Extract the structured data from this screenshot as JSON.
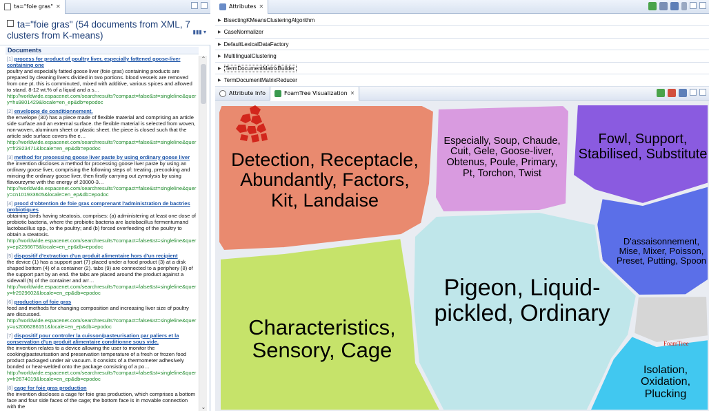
{
  "left_panel": {
    "tab_title": "ta=\"foie gras\"",
    "query_header": "ta=\"foie gras\" (54 documents from XML, 7 clusters from K-means)",
    "documents_label": "Documents",
    "documents": [
      {
        "num": "[1]",
        "title": "process for product of poultry liver, especially fattened goose-liver containing one",
        "snippet": "poultry and especially fatted goose liver (foie gras) containing products are prepared by cleaning livers divided in two portions. blood vessels are removed from one pt. this is comminuted, mixed with additive, various spices and allowed to stand. 8-12 wt.% of a liquid and a s…",
        "url": "http://worldwide.espacenet.com/searchresults?compact=false&st=singleline&query=hu9801429&locale=en_ep&db=epodoc"
      },
      {
        "num": "[2]",
        "title": "enveloppe de conditionnement.",
        "snippet": "the envelope (30) has a piece made of flexible material and comprising an article side surface and an external surface. the flexible material is selected from woven, non-woven, aluminum sheet or plastic sheet. the piece is closed such that the article side surface covers the e…",
        "url": "http://worldwide.espacenet.com/searchresults?compact=false&st=singleline&query=fr2923471&locale=en_ep&db=epodoc"
      },
      {
        "num": "[3]",
        "title": "method for processing goose liver paste by using ordinary goose liver",
        "snippet": "the invention discloses a method for processing goose liver paste by using an ordinary goose liver, comprising the following steps of: treating, precooking and mincing the ordinary goose liver, then firstly carrying out zymolysis by using flavourzyme with the energy of 20000-3…",
        "url": "http://worldwide.espacenet.com/searchresults?compact=false&st=singleline&query=cn101933605&locale=en_ep&db=epodoc"
      },
      {
        "num": "[4]",
        "title": "procd d'obtention de foie gras comprenant l'administration de bactries probiotiques",
        "snippet": "obtaining birds having steatosis, comprises: (a) administering at least one dose of probiotic bacteria, where the probiotic bacteria are lactobacillus fermentumand lactobacillus spp., to the poultry; and (b) forced overfeeding of the poultry to obtain a steatosis.",
        "url": "http://worldwide.espacenet.com/searchresults?compact=false&st=singleline&query=ep2256675&locale=en_ep&db=epodoc"
      },
      {
        "num": "[5]",
        "title": "dispositif d'extraction d'un produit alimentaire hors d'un recipient",
        "snippet": "the device (1) has a support part (7) placed under a food product (3) at a disk shaped bottom (4) of a container (2). tabs (9) are connected to a periphery (8) of the support part by an end. the tabs are placed around the product against a sidewall (5) of the container and arr…",
        "url": "http://worldwide.espacenet.com/searchresults?compact=false&st=singleline&query=fr2929602&locale=en_ep&db=epodoc"
      },
      {
        "num": "[6]",
        "title": "production of foie gras",
        "snippet": "feed and methods for changing composition and increasing liver size of poultry are discussed.",
        "url": "http://worldwide.espacenet.com/searchresults?compact=false&st=singleline&query=us2006286151&locale=en_ep&db=epodoc"
      },
      {
        "num": "[7]",
        "title": "dispositif pour controler la cuisson/pasteurisation par paliers et la conservation d'un produit alimentaire conditionne sous vide.",
        "snippet": "the invention relates to a device allowing the user to monitor the cooking/pasteurisation and preservation temperature of a fresh or frozen food product packaged under air vacuum. it consists of a thermometer adhesively bonded or heat-welded onto the package consisting of a po…",
        "url": "http://worldwide.espacenet.com/searchresults?compact=false&st=singleline&query=fr2674019&locale=en_ep&db=epodoc"
      },
      {
        "num": "[8]",
        "title": "cage for foie gras production",
        "snippet": "the invention discloses a cage for foie gras production, which comprises a bottom face and four side faces of the cage; the bottom face is in movable connection with the",
        "url": ""
      }
    ]
  },
  "attributes_panel": {
    "tab_title": "Attributes",
    "rows": [
      {
        "label": "BisectingKMeansClusteringAlgorithm",
        "selected": false
      },
      {
        "label": "CaseNormalizer",
        "selected": false
      },
      {
        "label": "DefaultLexicalDataFactory",
        "selected": false
      },
      {
        "label": "MultilingualClustering",
        "selected": false
      },
      {
        "label": "TermDocumentMatrixBuilder",
        "selected": true
      },
      {
        "label": "TermDocumentMatrixReducer",
        "selected": false
      }
    ]
  },
  "foam_panel": {
    "tab_attr_info": "Attribute Info",
    "tab_foamtree": "FoamTree Visualization",
    "logo_text": "FoamTree",
    "clusters": [
      {
        "label": "Detection, Receptacle, Abundantly, Factors, Kit, Landaise",
        "color": "#e98a6f"
      },
      {
        "label": "Especially, Soup, Chaude, Cuit, Gele, Goose-liver, Obtenus, Poule, Primary, Pt, Torchon, Twist",
        "color": "#d99be0"
      },
      {
        "label": "Fowl, Support, Stabilised, Substitute",
        "color": "#8a5be0"
      },
      {
        "label": "D'assaisonnement, Mise, Mixer, Poisson, Preset, Putting, Spoon",
        "color": "#5b6fe8"
      },
      {
        "label": "Pigeon, Liquid-pickled, Ordinary",
        "color": "#bfe6ea"
      },
      {
        "label": "Characteristics, Sensory, Cage",
        "color": "#c6e36a"
      },
      {
        "label": "Isolation, Oxidation, Plucking",
        "color": "#41c8f0"
      }
    ]
  }
}
